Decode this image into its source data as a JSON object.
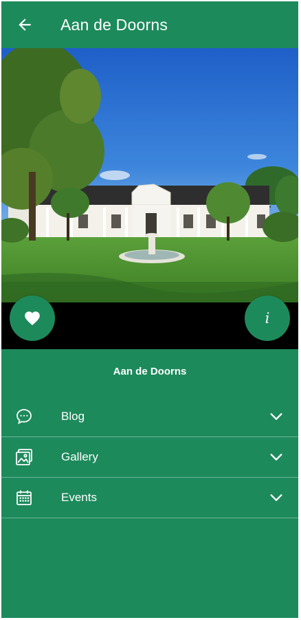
{
  "app_bar": {
    "title": "Aan de Doorns",
    "back_icon": "arrow-left-icon"
  },
  "hero": {
    "image_subject": "farmhouse photo"
  },
  "actions": {
    "favorite_icon": "heart-icon",
    "info_icon": "info-icon",
    "info_glyph": "i"
  },
  "content": {
    "place_name": "Aan de Doorns",
    "sections": [
      {
        "label": "Blog",
        "icon": "chat-bubble-icon"
      },
      {
        "label": "Gallery",
        "icon": "gallery-icon"
      },
      {
        "label": "Events",
        "icon": "calendar-icon"
      }
    ]
  },
  "colors": {
    "primary": "#1d8a5c",
    "on_primary": "#ffffff",
    "bar": "#000000"
  }
}
